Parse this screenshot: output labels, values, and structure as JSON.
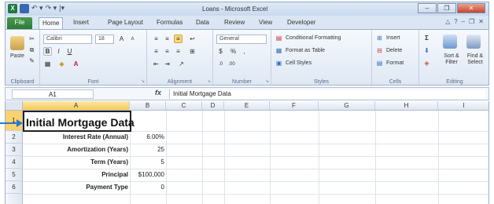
{
  "window": {
    "title": "Loans - Microsoft Excel"
  },
  "tabs": [
    {
      "label": "File"
    },
    {
      "label": "Home"
    },
    {
      "label": "Insert"
    },
    {
      "label": "Page Layout"
    },
    {
      "label": "Formulas"
    },
    {
      "label": "Data"
    },
    {
      "label": "Review"
    },
    {
      "label": "View"
    },
    {
      "label": "Developer"
    }
  ],
  "ribbon": {
    "clipboard": {
      "paste_label": "Paste",
      "group_label": "Clipboard"
    },
    "font": {
      "font_name": "Calibri",
      "font_size": "18",
      "group_label": "Font",
      "bold": "B",
      "italic": "I",
      "underline": "U",
      "grow": "A",
      "shrink": "A"
    },
    "alignment": {
      "group_label": "Alignment"
    },
    "number": {
      "format": "General",
      "currency": "$",
      "percent": "%",
      "comma": ",",
      "group_label": "Number"
    },
    "styles": {
      "conditional": "Conditional Formatting",
      "format_table": "Format as Table",
      "cell_styles": "Cell Styles",
      "group_label": "Styles"
    },
    "cells": {
      "insert": "Insert",
      "delete": "Delete",
      "format": "Format",
      "group_label": "Cells"
    },
    "editing": {
      "sigma": "Σ",
      "sort_filter": "Sort & Filter",
      "find_select": "Find & Select",
      "group_label": "Editing"
    }
  },
  "formula_bar": {
    "name_box": "A1",
    "fx": "fx",
    "content": "Initial Mortgage Data"
  },
  "columns": [
    "A",
    "B",
    "C",
    "D",
    "E",
    "F",
    "G",
    "H",
    "I"
  ],
  "rows": [
    "1",
    "2",
    "3",
    "4",
    "5",
    "6"
  ],
  "cells": {
    "a1": "Initial Mortgage Data",
    "a2": "Interest Rate (Annual)",
    "b2": "6.00%",
    "a3": "Amortization (Years)",
    "b3": "25",
    "a4": "Term (Years)",
    "b4": "5",
    "a5": "Principal",
    "b5": "$100,000",
    "a6": "Payment Type",
    "b6": "0"
  }
}
